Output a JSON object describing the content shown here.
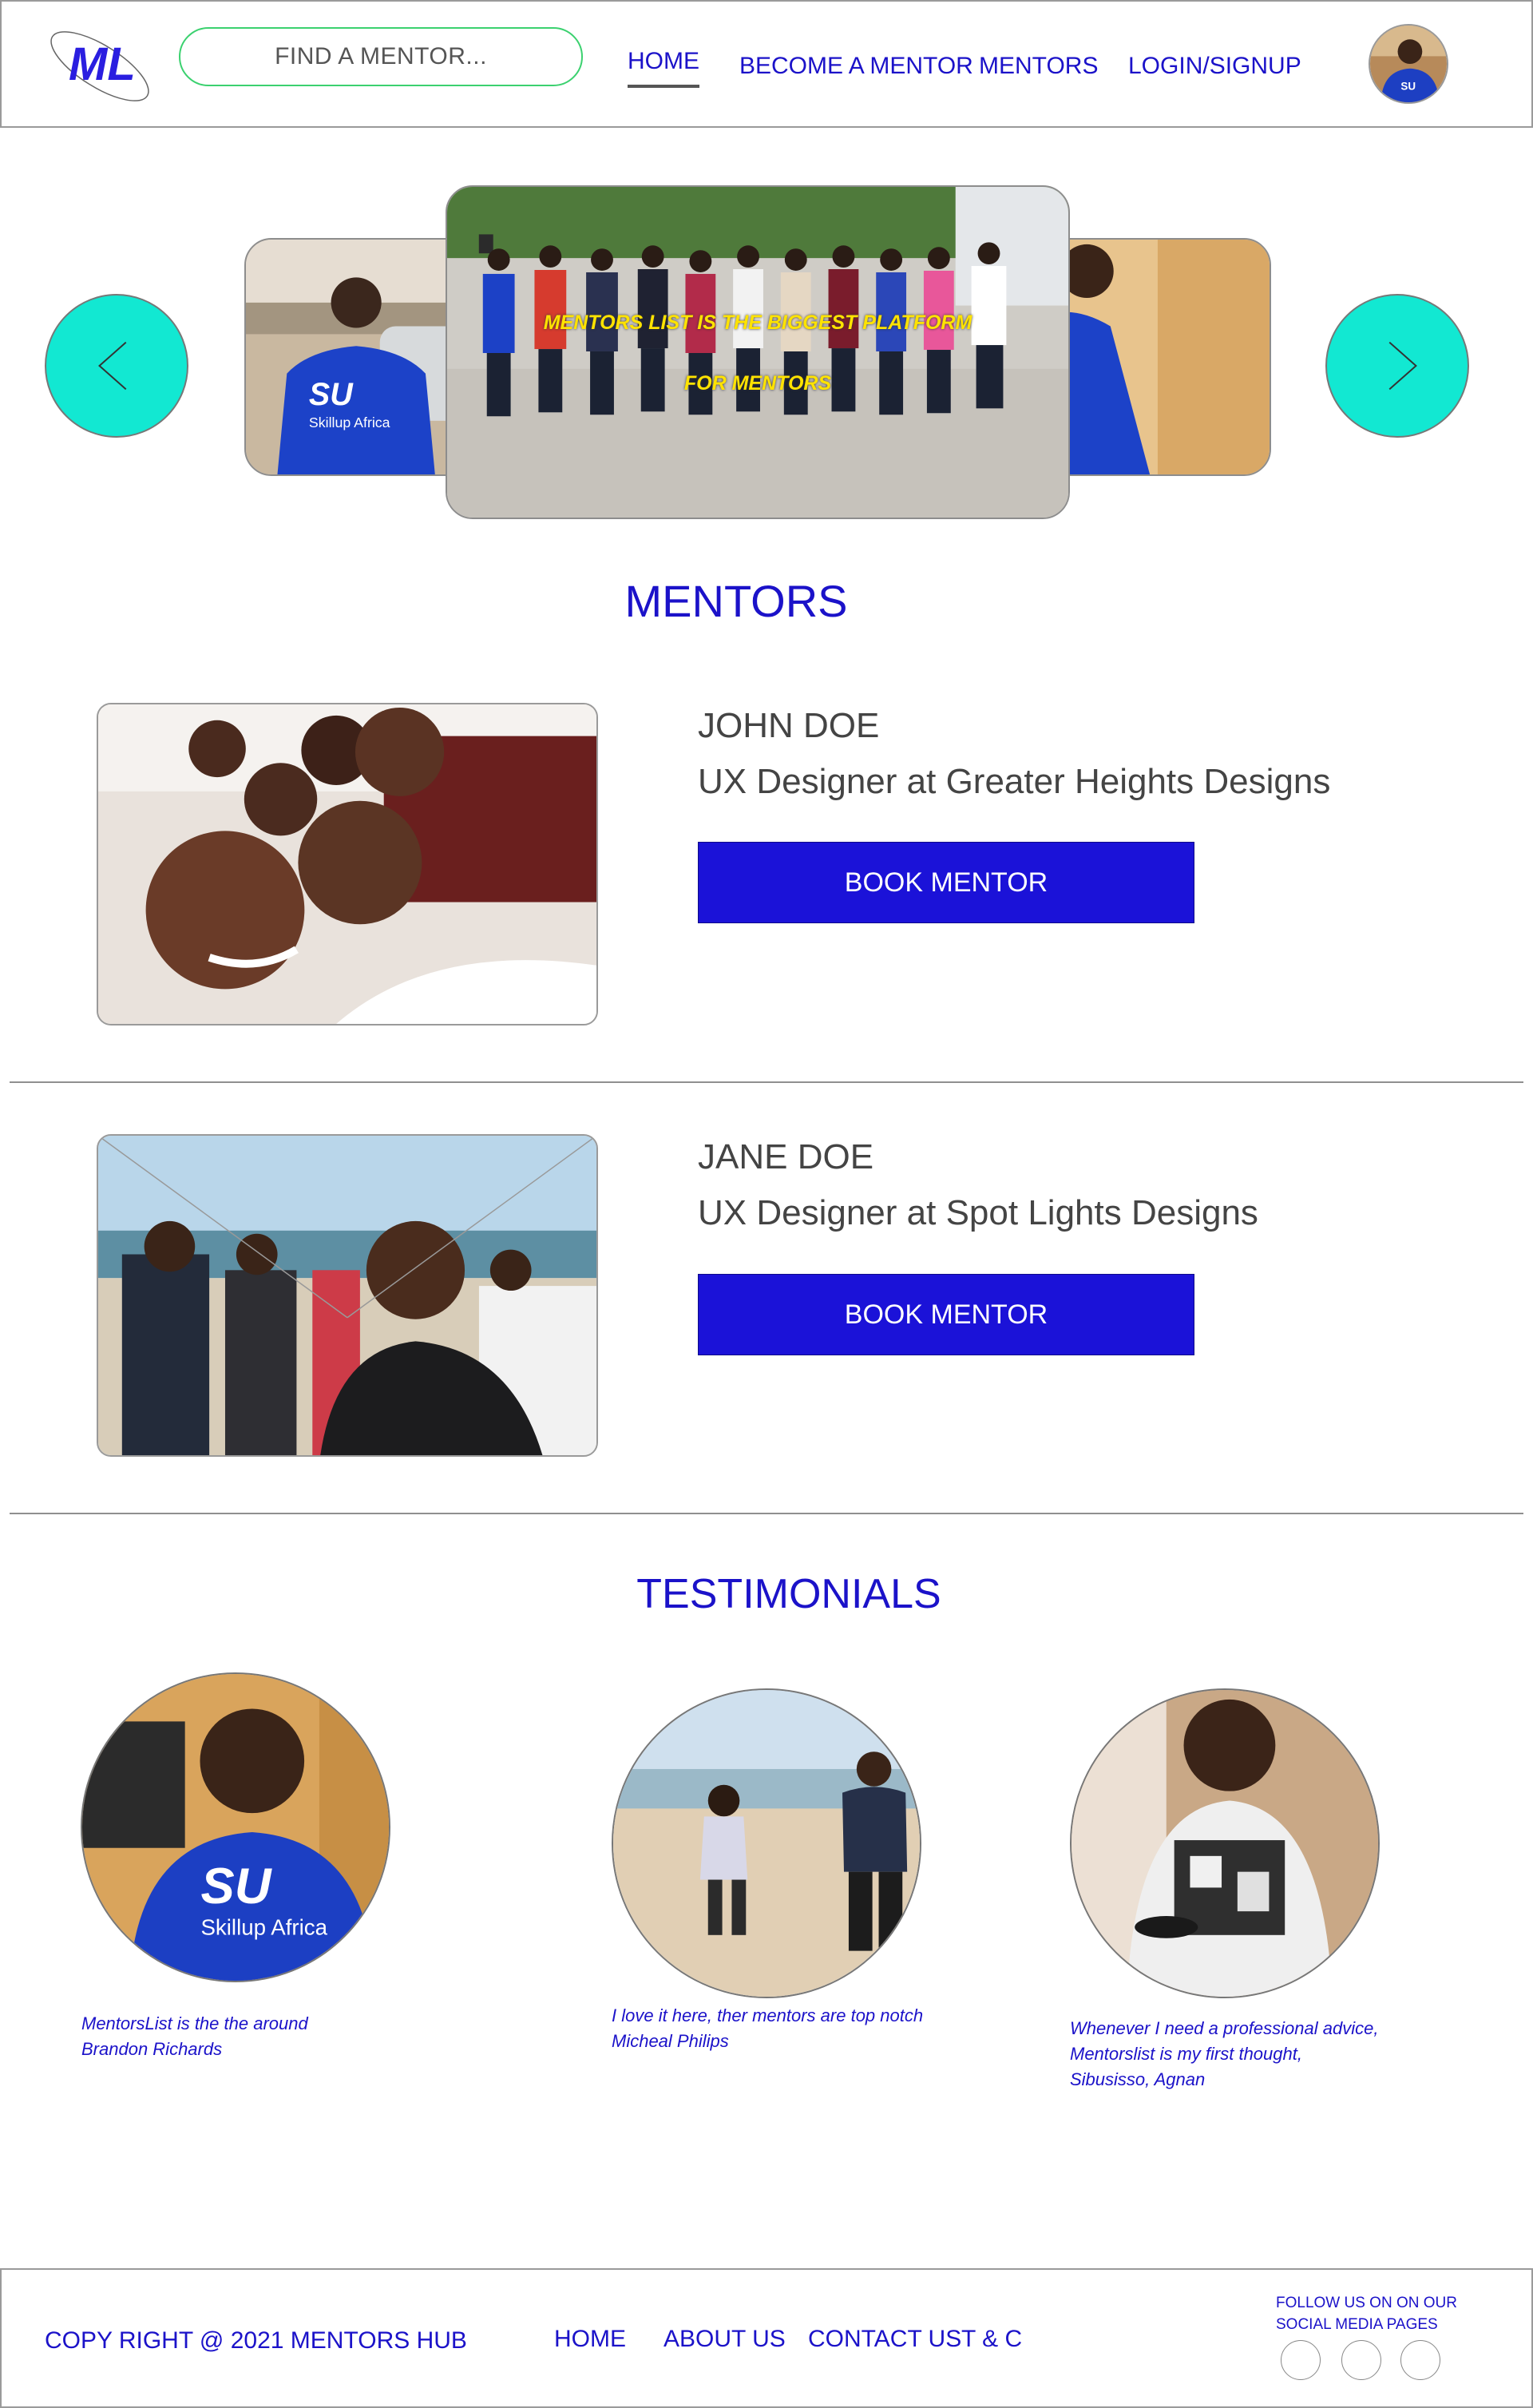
{
  "header": {
    "logo_text": "ML",
    "search_placeholder": "FIND A MENTOR...",
    "nav": {
      "home": "HOME",
      "become_mentor": "BECOME A MENTOR",
      "mentors": "MENTORS",
      "login": "LOGIN/SIGNUP"
    }
  },
  "carousel": {
    "caption_line1": "MENTORS LIST IS THE BIGGEST PLATFORM",
    "caption_line2": "FOR MENTORS"
  },
  "mentors_section": {
    "title": "MENTORS",
    "items": [
      {
        "name": "JOHN DOE",
        "role": "UX Designer at Greater Heights Designs",
        "button": "BOOK MENTOR"
      },
      {
        "name": "JANE DOE",
        "role": "UX Designer at Spot Lights Designs",
        "button": "BOOK MENTOR"
      }
    ]
  },
  "testimonials": {
    "title": "TESTIMONIALS",
    "items": [
      {
        "quote": "MentorsList is the the around",
        "author": "Brandon Richards"
      },
      {
        "quote": "I love it here, ther mentors are top notch",
        "author": "Micheal Philips"
      },
      {
        "quote": "Whenever I need a professional advice,",
        "quote2": "Mentorslist is my first thought,",
        "author": "Sibusisso, Agnan"
      }
    ]
  },
  "footer": {
    "copyright": "COPY RIGHT @ 2021 MENTORS HUB",
    "links": {
      "home": "HOME",
      "about": "ABOUT US",
      "contact": "CONTACT US",
      "tc": "T & C"
    },
    "follow_line1": "FOLLOW US ON ON OUR",
    "follow_line2": "SOCIAL MEDIA PAGES"
  },
  "colors": {
    "brand_blue": "#1b12c9",
    "button_blue": "#1b12d8",
    "arrow_teal": "#12e8d2",
    "search_border": "#3bd16f",
    "caption_yellow": "#ffe300"
  }
}
